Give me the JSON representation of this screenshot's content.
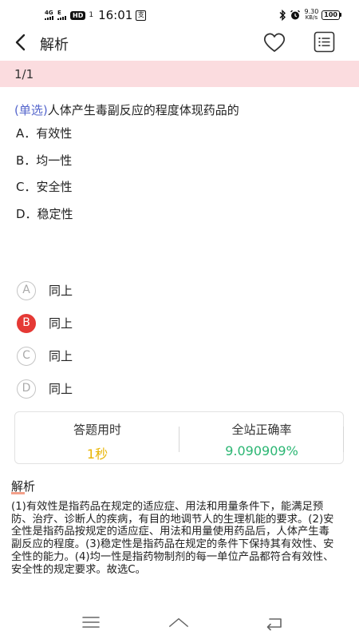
{
  "status_bar": {
    "network_small": "4G",
    "network_small_2": "E",
    "hd_badge": "HD",
    "signal_digit": "1",
    "time": "16:01",
    "notification_glyph": "支",
    "speed_value": "9.30",
    "speed_unit": "KB/s",
    "battery": "100",
    "icons": [
      "signal-icon",
      "hd-icon",
      "notification-icon",
      "bluetooth-icon",
      "alarm-icon",
      "battery-icon"
    ]
  },
  "header": {
    "title": "解析",
    "icons": [
      "back-arrow-icon",
      "heart-icon",
      "list-icon"
    ]
  },
  "progress": {
    "text": "1/1"
  },
  "question": {
    "type_label": "(单选)",
    "stem": "人体产生毒副反应的程度体现药品的",
    "options": [
      "A．有效性",
      "B．均一性",
      "C．安全性",
      "D．稳定性"
    ]
  },
  "answers": [
    {
      "letter": "A",
      "label": "同上",
      "selected": false
    },
    {
      "letter": "B",
      "label": "同上",
      "selected": true
    },
    {
      "letter": "C",
      "label": "同上",
      "selected": false
    },
    {
      "letter": "D",
      "label": "同上",
      "selected": false
    }
  ],
  "stats": {
    "time_label": "答题用时",
    "time_value": "1秒",
    "rate_label": "全站正确率",
    "rate_value": "9.090909%"
  },
  "analysis": {
    "title": "解析",
    "text": "(1)有效性是指药品在规定的适应症、用法和用量条件下，能满足预防、治疗、诊断人的疾病，有目的地调节人的生理机能的要求。(2)安全性是指药品按规定的适应症、用法和用量使用药品后，人体产生毒副反应的程度。(3)稳定性是指药品在规定的条件下保持其有效性、安全性的能力。(4)均一性是指药物制剂的每一单位产品都符合有效性、安全性的规定要求。故选C。"
  },
  "colors": {
    "progress_bg": "#fbdcdf",
    "selected": "#e53935",
    "time_value": "#e8b400",
    "rate_value": "#2bb673",
    "question_type": "#5566cc",
    "analysis_underline": "#f3a08a"
  },
  "nav_bar": {
    "icons": [
      "menu-icon",
      "home-icon",
      "back-icon"
    ]
  }
}
